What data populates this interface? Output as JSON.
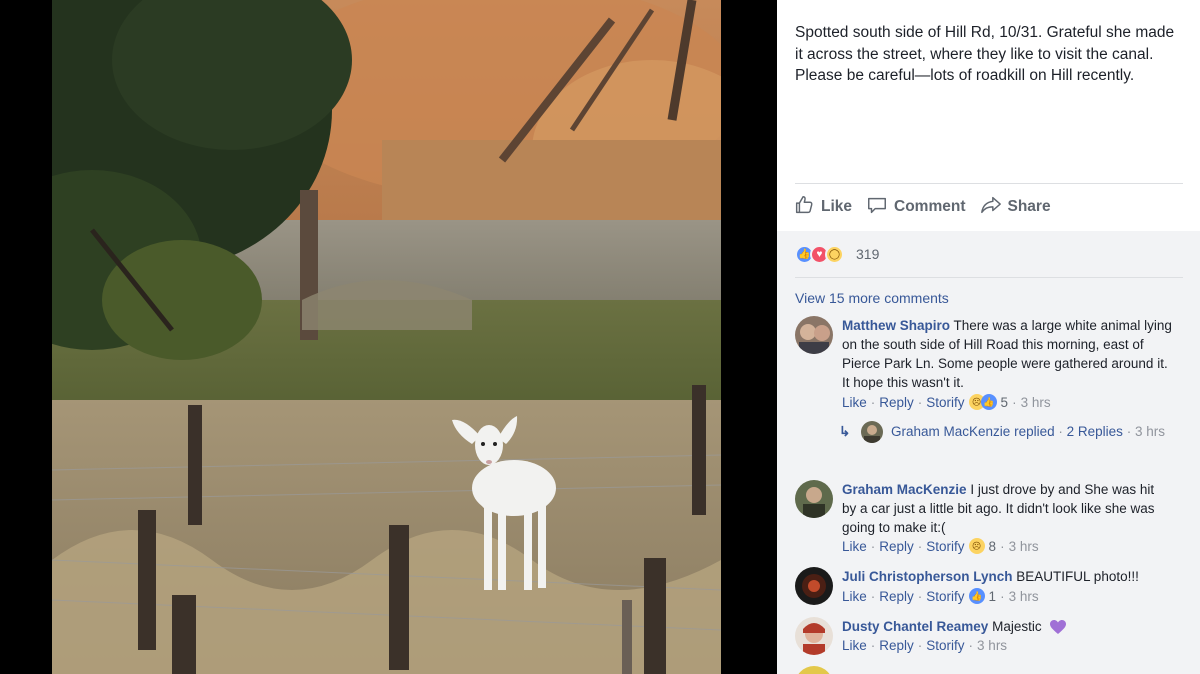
{
  "post": {
    "caption": "Spotted south side of Hill Rd, 10/31. Grateful she made it across the street, where they like to visit the canal. Please be careful—lots of roadkill on Hill recently."
  },
  "actions": {
    "like_label": "Like",
    "comment_label": "Comment",
    "share_label": "Share",
    "icons": [
      "thumbs-up-icon",
      "comment-bubble-icon",
      "share-arrow-icon"
    ]
  },
  "reactions": {
    "types": [
      "like",
      "love",
      "wow"
    ],
    "count": "319"
  },
  "comments": {
    "view_more": "View 15 more comments",
    "items": [
      {
        "author": "Matthew Shapiro",
        "text": "There was a large white animal lying on the south side of Hill Road this morning, east of Pierce Park Ln. Some people were gathered around it. It hope this wasn't it.",
        "like": "Like",
        "reply": "Reply",
        "storify": "Storify",
        "reaction_count": "5",
        "time": "3 hrs"
      },
      {
        "author": "Graham MacKenzie",
        "text": "I just drove by and She was hit by a car just a little bit ago. It didn't look like she was going to make it:(",
        "like": "Like",
        "reply": "Reply",
        "storify": "Storify",
        "reaction_count": "8",
        "time": "3 hrs"
      },
      {
        "author": "Juli Christopherson Lynch",
        "text": "BEAUTIFUL photo!!!",
        "like": "Like",
        "reply": "Reply",
        "storify": "Storify",
        "reaction_count": "1",
        "time": "3 hrs"
      },
      {
        "author": "Dusty Chantel Reamey",
        "text": "Majestic",
        "like": "Like",
        "reply": "Reply",
        "storify": "Storify",
        "time": "3 hrs"
      }
    ],
    "reply_summary": {
      "author": "Graham MacKenzie",
      "replied": "replied",
      "replies": "2 Replies",
      "time": "3 hrs"
    }
  },
  "colors": {
    "link": "#385898",
    "like_reaction": "#5890ff",
    "love_reaction": "#f25268",
    "wow_reaction": "#fcd361"
  }
}
